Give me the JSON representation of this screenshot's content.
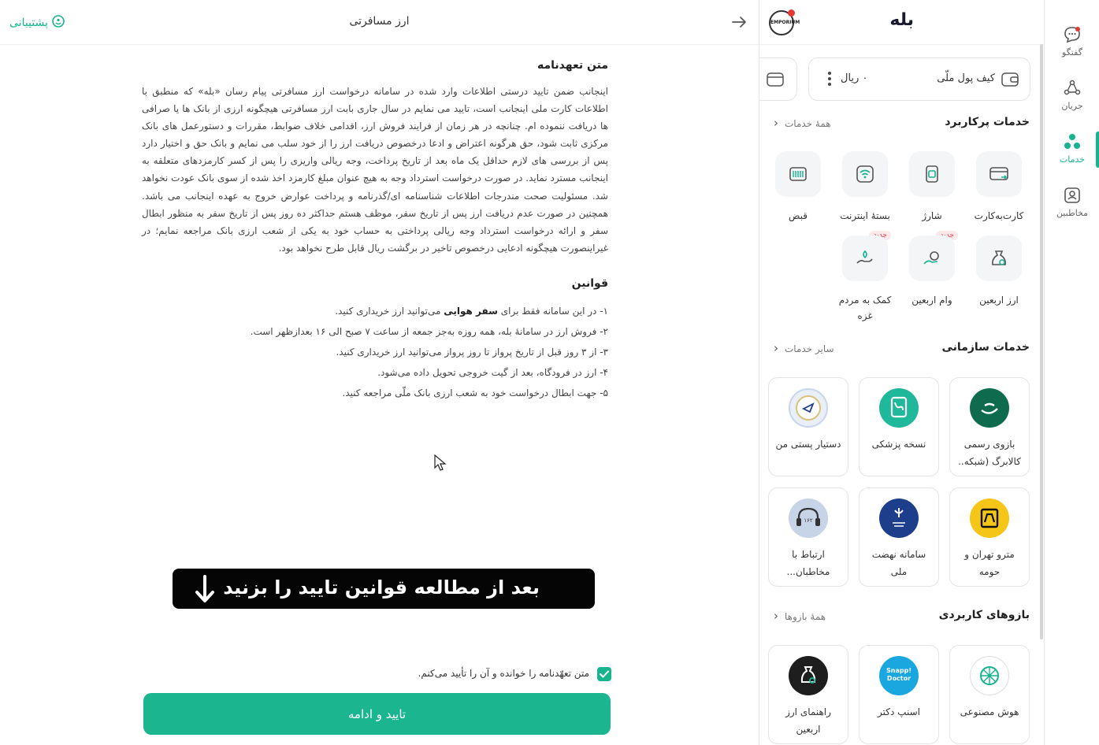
{
  "main": {
    "title": "ارز مسافرتی",
    "support_label": "پشتیبانی",
    "commitment_heading": "متن تعهدنامه",
    "commitment_text": "اینجانب ضمن تایید درستی اطلاعات وارد شده در سامانه درخواست ارز مسافرتی پیام رسان «بله» که منطبق با اطلاعات کارت ملی اینجانب است، تایید می نمایم در سال جاری بابت ارز مسافرتی هیچگونه ارزی از بانک ها یا صرافی ها دریافت ننموده ام. چنانچه در هر زمان از فرایند فروش ارز، اقدامی خلاف ضوابط، مقررات و دستورعمل های بانک مرکزی ثابت شود، حق هرگونه اعتراض و ادعا درخصوص دریافت ارز را از خود سلب می نمایم و بانک حق و اختیار دارد پس از بررسی های لازم حداقل یک ماه بعد از تاریخ پرداخت، وجه ریالی واریزی را پس از کسر کارمزدهای متعلقه به اینجانب مسترد نماید. در صورت درخواست استرداد وجه به هیچ عنوان مبلغ کارمزد اخذ شده از سوی بانک عودت نخواهد شد. مسئولیت صحت مندرجات اطلاعات شناسنامه ای/گذرنامه و پرداخت عوارض خروج به عهده اینجانب می باشد. همچنین در صورت عدم دریافت ارز پس از تاریخ سفر، موظف هستم حداکثر ده روز پس از تاریخ سفر به منظور ابطال سفر و ارائه درخواست استرداد وجه ریالی پرداختی به حساب خود به یکی از شعب ارزی بانک مراجعه نمایم؛ در غیراینصورت هیچگونه ادعایی درخصوص تاخیر در برگشت ریال قابل طرح نخواهد بود.",
    "rules_heading": "قوانین",
    "rules": [
      {
        "pre": "۱- در این سامانه فقط برای ",
        "bold": "سفر هوایی",
        "post": " می‌توانید ارز خریداری کنید."
      },
      {
        "pre": "۲- فروش ارز در سامانهٔ بله، همه روزه به‌جز جمعه از ساعت ۷ صبح الی ۱۶ بعدازظهر است.",
        "bold": "",
        "post": ""
      },
      {
        "pre": "۳- از ۳ روز قبل از تاریخ پرواز تا روز پرواز می‌توانید ارز خریداری کنید.",
        "bold": "",
        "post": ""
      },
      {
        "pre": "۴- ارز در فرودگاه، بعد از گیت خروجی تحویل داده می‌شود.",
        "bold": "",
        "post": ""
      },
      {
        "pre": "۵- جهت ابطال درخواست خود به شعب ارزی بانک ملّی مراجعه کنید.",
        "bold": "",
        "post": ""
      }
    ],
    "banner_text": "بعد از مطالعه قوانین تایید را بزنید",
    "agree_label": "متن تعهّدنامه را خوانده و آن را تأیید می‌کنم.",
    "agree_checked": true,
    "confirm_label": "تایید و ادامه"
  },
  "services": {
    "brand": "بله",
    "wallet_label": "کیف پول ملّی",
    "wallet_balance": "۰ ریال",
    "user_services_title": "خدمات پرکاربرد",
    "user_services_link": "همهٔ خدمات",
    "user_services": [
      {
        "label": "کارت‌به‌کارت",
        "icon": "card-transfer-icon",
        "new": ""
      },
      {
        "label": "شارژ",
        "icon": "sim-charge-icon",
        "new": ""
      },
      {
        "label": "بستهٔ اینترنت",
        "icon": "wifi-icon",
        "new": ""
      },
      {
        "label": "قبض",
        "icon": "bill-icon",
        "new": ""
      },
      {
        "label": "ارز اربعین",
        "icon": "currency-bag-icon",
        "new": ""
      },
      {
        "label": "وام اربعین",
        "icon": "loan-icon",
        "new": "جدید"
      },
      {
        "label": "کمک به مردم غزه",
        "icon": "donate-icon",
        "new": "جدید"
      }
    ],
    "org_services_title": "خدمات سازمانی",
    "org_services_link": "سایر خدمات",
    "org_services": [
      {
        "label": "بازوی رسمی کالابرگ (شبکه..",
        "color": "#0e6b4e"
      },
      {
        "label": "نسخه پزشکی",
        "color": "#1fb89a"
      },
      {
        "label": "دستیار پستی من",
        "color": "#e9eef7"
      },
      {
        "label": "مترو تهران و حومه",
        "color": "#f5c518"
      },
      {
        "label": "سامانه نهضت ملی",
        "color": "#1d3e8a"
      },
      {
        "label": "ارتباط با مخاطبان...",
        "color": "#c7d3e6"
      }
    ],
    "apps_title": "بازوهای کاربردی",
    "apps_link": "همهٔ بازوها",
    "apps": [
      {
        "label": "هوش مصنوعی",
        "color": "#ffffff"
      },
      {
        "label": "اسنپ دکتر",
        "color": "#1aa7e0"
      },
      {
        "label": "راهنمای ارز اربعین",
        "color": "#1e1e1e"
      }
    ],
    "snapp_logo_text": "Snapp! Doctor",
    "emporium_text": "EMPORIUM",
    "tahran_emblem_text": "۱۶۲"
  },
  "rail": [
    {
      "label": "گفتگو",
      "icon": "chat-icon"
    },
    {
      "label": "جریان",
      "icon": "flow-icon"
    },
    {
      "label": "خدمات",
      "icon": "services-icon",
      "active": true
    },
    {
      "label": "مخاطبین",
      "icon": "contacts-icon"
    }
  ],
  "colors": {
    "accent": "#16b38f",
    "banner": "#050505",
    "new_badge": "#e5394b"
  }
}
